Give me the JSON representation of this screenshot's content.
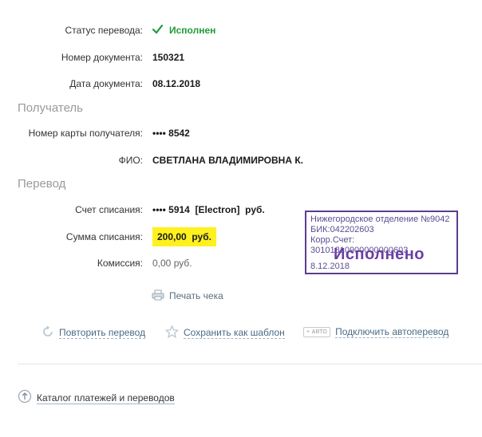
{
  "status": {
    "label": "Статус перевода:",
    "value": "Исполнен"
  },
  "doc_number": {
    "label": "Номер документа:",
    "value": "150321"
  },
  "doc_date": {
    "label": "Дата документа:",
    "value": "08.12.2018"
  },
  "recipient": {
    "heading": "Получатель",
    "card": {
      "label": "Номер карты получателя:",
      "value": "•••• 8542"
    },
    "name": {
      "label": "ФИО:",
      "value": "СВЕТЛАНА ВЛАДИМИРОВНА К."
    }
  },
  "transfer": {
    "heading": "Перевод",
    "account": {
      "label": "Счет списания:",
      "value": "•••• 5914  [Electron]  руб."
    },
    "amount": {
      "label": "Сумма списания:",
      "value": "200,00  руб."
    },
    "fee": {
      "label": "Комиссия:",
      "value": "0,00 руб."
    }
  },
  "print_receipt": "Печать чека",
  "actions": {
    "repeat": "Повторить перевод",
    "save_template": "Сохранить как шаблон",
    "auto_badge": "АВТО",
    "autopay": "Подключить автоперевод"
  },
  "stamp": {
    "line1": "Нижегородское отделение №9042",
    "line2": "БИК:042202603",
    "line3": "Корр.Счет: 30101810900000000603",
    "status": "Исполнено",
    "date": "8.12.2018"
  },
  "catalog_link": "Каталог платежей и переводов",
  "colors": {
    "success": "#1f9b3a",
    "highlight": "#fff01f",
    "stamp": "#5a3e8f",
    "link": "#4a6a86"
  }
}
